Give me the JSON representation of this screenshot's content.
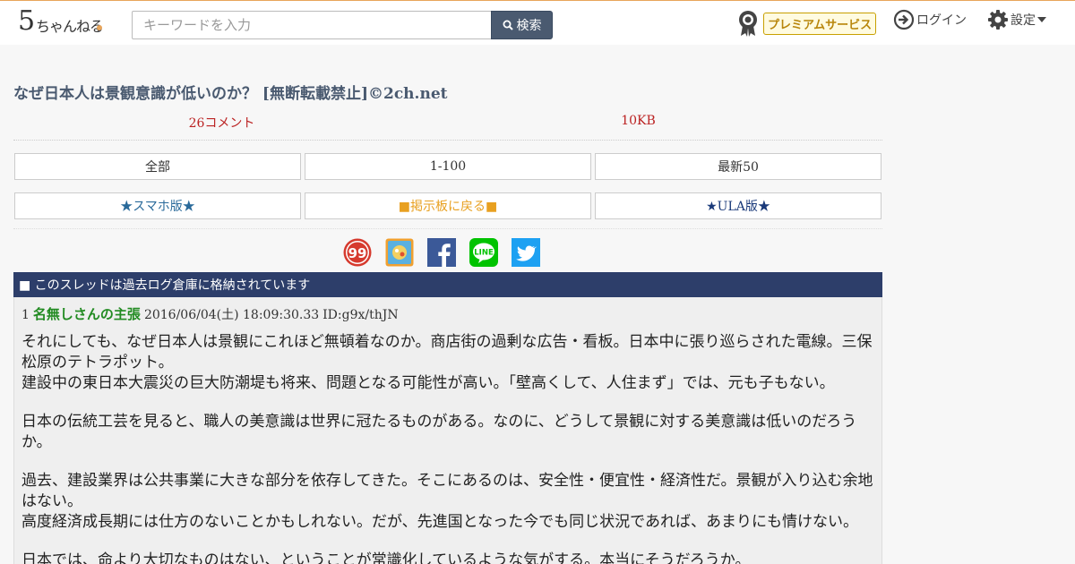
{
  "header": {
    "logo_text": "ちゃんねる",
    "logo_number": "5",
    "search": {
      "placeholder": "キーワードを入力",
      "button_label": "検索"
    },
    "premium_label": "プレミアムサービス",
    "login_label": "ログイン",
    "settings_label": "設定"
  },
  "thread": {
    "title": "なぜ日本人は景観意識が低いのか？ [無断転載禁止]©2ch.net",
    "comment_count": "26コメント",
    "size": "10KB"
  },
  "nav": {
    "row1": [
      "全部",
      "1-100",
      "最新50"
    ],
    "row2": [
      "★スマホ版★",
      "■掲示板に戻る■",
      "★ULA版★"
    ]
  },
  "share_icons": [
    "sugu-icon",
    "bookmark-icon",
    "facebook-icon",
    "line-icon",
    "twitter-icon"
  ],
  "banner": "■ このスレッドは過去ログ倉庫に格納されています",
  "post": {
    "number": "1",
    "name": "名無しさんの主張",
    "date": "2016/06/04(土) 18:09:30.33",
    "id": "ID:g9x/thJN",
    "paragraphs": [
      [
        "それにしても、なぜ日本人は景観にこれほど無頓着なのか。商店街の過剰な広告・看板。日本中に張り巡らされた電線。三保松原のテトラポット。",
        "建設中の東日本大震災の巨大防潮堤も将来、問題となる可能性が高い。「壁高くして、人住まず」では、元も子もない。"
      ],
      [
        "日本の伝統工芸を見ると、職人の美意識は世界に冠たるものがある。なのに、どうして景観に対する美意識は低いのだろうか。"
      ],
      [
        "過去、建設業界は公共事業に大きな部分を依存してきた。そこにあるのは、安全性・便宜性・経済性だ。景観が入り込む余地はない。",
        "高度経済成長期には仕方のないことかもしれない。だが、先進国となった今でも同じ状況であれば、あまりにも情けない。"
      ],
      [
        "日本では、命より大切なものはない、ということが常識化しているような気がする。本当にそうだろうか。"
      ]
    ]
  },
  "colors": {
    "header_accent": "#e8a55a",
    "title": "#4a5a70",
    "meta_red": "#bb2222",
    "banner_bg": "#2d3e6a",
    "name_green": "#228b22",
    "facebook": "#3b5998",
    "line": "#00c300",
    "twitter": "#1da1f2"
  }
}
